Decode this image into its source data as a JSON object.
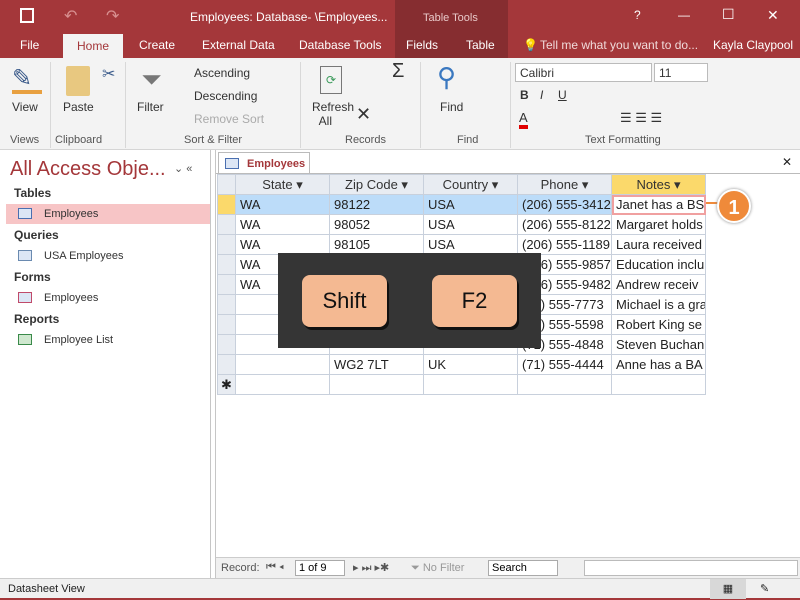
{
  "title": "Employees: Database- \\Employees...",
  "context_tab": "Table Tools",
  "window_controls": [
    "?",
    "—",
    "☐",
    "✕"
  ],
  "tabs": [
    "File",
    "Home",
    "Create",
    "External Data",
    "Database Tools",
    "Fields",
    "Table"
  ],
  "tell_me": "Tell me what you want to do...",
  "user": "Kayla Claypool",
  "ribbon": {
    "view": "View",
    "paste": "Paste",
    "filter": "Filter",
    "ascending": "Ascending",
    "descending": "Descending",
    "remove_sort": "Remove Sort",
    "refresh": "Refresh",
    "refresh2": "All",
    "find": "Find",
    "font": "Calibri",
    "size": "11",
    "bold": "B",
    "italic": "I",
    "underline": "U",
    "groups": [
      "Views",
      "Clipboard",
      "Sort & Filter",
      "Records",
      "Find",
      "Text Formatting"
    ],
    "font_color": "#e00000"
  },
  "nav": {
    "title": "All Access Obje...",
    "sections": [
      {
        "label": "Tables",
        "item": "Employees"
      },
      {
        "label": "Queries",
        "item": "USA Employees"
      },
      {
        "label": "Forms",
        "item": "Employees"
      },
      {
        "label": "Reports",
        "item": "Employee List"
      }
    ]
  },
  "doc_tab": "Employees",
  "columns": [
    "State",
    "Zip Code",
    "Country",
    "Phone",
    "Notes"
  ],
  "rows": [
    [
      "WA",
      "98122",
      "USA",
      "(206) 555-3412",
      "Janet has a BS"
    ],
    [
      "WA",
      "98052",
      "USA",
      "(206) 555-8122",
      "Margaret holds"
    ],
    [
      "WA",
      "98105",
      "USA",
      "(206) 555-1189",
      "Laura received"
    ],
    [
      "WA",
      "",
      "",
      "(206) 555-9857",
      "Education inclu"
    ],
    [
      "WA",
      "",
      "",
      "(206) 555-9482",
      "Andrew receiv"
    ],
    [
      "",
      "",
      "",
      "(71) 555-7773",
      "Michael is a gra"
    ],
    [
      "",
      "",
      "",
      "(71) 555-5598",
      "Robert King se"
    ],
    [
      "",
      "",
      "",
      "(71) 555-4848",
      "Steven Buchan"
    ],
    [
      "",
      "WG2 7LT",
      "UK",
      "(71) 555-4444",
      "Anne has a BA"
    ]
  ],
  "new_row_marker": "✱",
  "keys": [
    "Shift",
    "F2"
  ],
  "callout": "1",
  "record_bar": {
    "label": "Record:",
    "position": "1 of 9",
    "filter": "No Filter",
    "search": "Search"
  },
  "status": "Datasheet View",
  "colors": {
    "accent": "#a4373a",
    "selected_row": "#bcdcf9",
    "key": "#f4b992",
    "callout": "#ef8a3a"
  }
}
